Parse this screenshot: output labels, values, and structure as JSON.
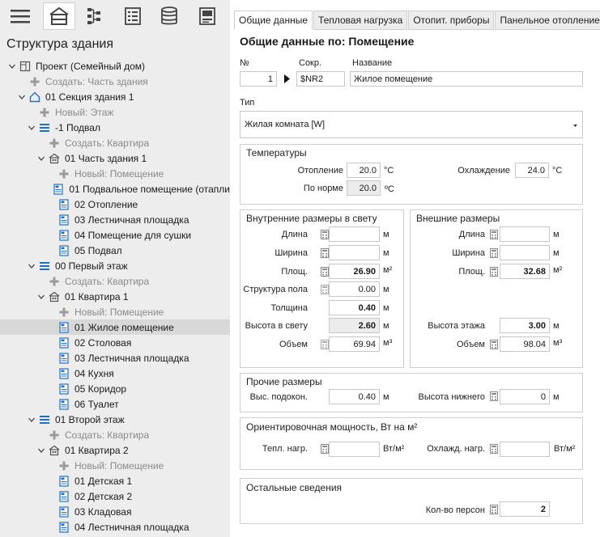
{
  "toolbar": {
    "buttons": [
      {
        "icon": "menu-icon"
      },
      {
        "icon": "building-icon"
      },
      {
        "icon": "network-icon"
      },
      {
        "icon": "list-icon"
      },
      {
        "icon": "database-icon"
      },
      {
        "icon": "panel-icon"
      }
    ]
  },
  "tree": {
    "title": "Структура здания",
    "items": [
      {
        "label": "Проект (Семейный дом)",
        "icon": "project-icon",
        "indent": 0,
        "expander": true,
        "gray": false
      },
      {
        "label": "Создать: Часть здания",
        "icon": "plus-icon",
        "indent": 1,
        "expander": false,
        "gray": true
      },
      {
        "label": "01 Секция здания 1",
        "icon": "house-icon",
        "indent": 1,
        "expander": true,
        "gray": false
      },
      {
        "label": "Новый: Этаж",
        "icon": "plus-icon",
        "indent": 2,
        "expander": false,
        "gray": true
      },
      {
        "label": "-1 Подвал",
        "icon": "floor-icon",
        "indent": 2,
        "expander": true,
        "gray": false
      },
      {
        "label": "Создать: Квартира",
        "icon": "plus-icon",
        "indent": 3,
        "expander": false,
        "gray": true
      },
      {
        "label": "01 Часть здания 1",
        "icon": "apartment-icon",
        "indent": 3,
        "expander": true,
        "gray": false
      },
      {
        "label": "Новый: Помещение",
        "icon": "plus-icon",
        "indent": 4,
        "expander": false,
        "gray": true
      },
      {
        "label": "01 Подвальное помещение (отапли",
        "icon": "room-icon",
        "indent": 4,
        "expander": false,
        "gray": false
      },
      {
        "label": "02 Отопление",
        "icon": "room-icon",
        "indent": 4,
        "expander": false,
        "gray": false
      },
      {
        "label": "03 Лестничная площадка",
        "icon": "room-icon",
        "indent": 4,
        "expander": false,
        "gray": false
      },
      {
        "label": "04 Помещение для сушки",
        "icon": "room-icon",
        "indent": 4,
        "expander": false,
        "gray": false
      },
      {
        "label": "05 Подвал",
        "icon": "room-icon",
        "indent": 4,
        "expander": false,
        "gray": false
      },
      {
        "label": "00 Первый этаж",
        "icon": "floor-icon",
        "indent": 2,
        "expander": true,
        "gray": false
      },
      {
        "label": "Создать: Квартира",
        "icon": "plus-icon",
        "indent": 3,
        "expander": false,
        "gray": true
      },
      {
        "label": "01 Квартира 1",
        "icon": "apartment-icon",
        "indent": 3,
        "expander": true,
        "gray": false
      },
      {
        "label": "Новый: Помещение",
        "icon": "plus-icon",
        "indent": 4,
        "expander": false,
        "gray": true
      },
      {
        "label": "01 Жилое помещение",
        "icon": "room-icon",
        "indent": 4,
        "expander": false,
        "gray": false,
        "selected": true
      },
      {
        "label": "02 Столовая",
        "icon": "room-icon",
        "indent": 4,
        "expander": false,
        "gray": false
      },
      {
        "label": "03 Лестничная площадка",
        "icon": "room-icon",
        "indent": 4,
        "expander": false,
        "gray": false
      },
      {
        "label": "04 Кухня",
        "icon": "room-icon",
        "indent": 4,
        "expander": false,
        "gray": false
      },
      {
        "label": "05 Коридор",
        "icon": "room-icon",
        "indent": 4,
        "expander": false,
        "gray": false
      },
      {
        "label": "06 Туалет",
        "icon": "room-icon",
        "indent": 4,
        "expander": false,
        "gray": false
      },
      {
        "label": "01 Второй этаж",
        "icon": "floor-icon",
        "indent": 2,
        "expander": true,
        "gray": false
      },
      {
        "label": "Создать: Квартира",
        "icon": "plus-icon",
        "indent": 3,
        "expander": false,
        "gray": true
      },
      {
        "label": "01 Квартира 2",
        "icon": "apartment-icon",
        "indent": 3,
        "expander": true,
        "gray": false
      },
      {
        "label": "Новый: Помещение",
        "icon": "plus-icon",
        "indent": 4,
        "expander": false,
        "gray": true
      },
      {
        "label": "01 Детская 1",
        "icon": "room-icon",
        "indent": 4,
        "expander": false,
        "gray": false
      },
      {
        "label": "02 Детская 2",
        "icon": "room-icon",
        "indent": 4,
        "expander": false,
        "gray": false
      },
      {
        "label": "03 Кладовая",
        "icon": "room-icon",
        "indent": 4,
        "expander": false,
        "gray": false
      },
      {
        "label": "04 Лестничная площадка",
        "icon": "room-icon",
        "indent": 4,
        "expander": false,
        "gray": false
      }
    ]
  },
  "tabs": [
    {
      "label": "Общие данные",
      "active": true
    },
    {
      "label": "Тепловая нагрузка",
      "active": false
    },
    {
      "label": "Отопит. приборы",
      "active": false
    },
    {
      "label": "Панельное отопление",
      "active": false
    }
  ],
  "form": {
    "title": "Общие данные по: Помещение",
    "number": {
      "label": "№",
      "value": "1"
    },
    "abbr": {
      "label": "Сокр.",
      "value": "$NR2"
    },
    "name": {
      "label": "Название",
      "value": "Жилое помещение"
    },
    "type": {
      "label": "Тип",
      "value": "Жилая комната [W]"
    },
    "temps": {
      "title": "Температуры",
      "heating_label": "Отопление",
      "heating_value": "20.0",
      "heating_unit": "°C",
      "cooling_label": "Охлаждение",
      "cooling_value": "24.0",
      "cooling_unit": "°C",
      "norm_label": "По норме",
      "norm_value": "20.0",
      "norm_unit": "ºC"
    },
    "inner": {
      "title": "Внутренние размеры в свету",
      "length_label": "Длина",
      "length_value": "",
      "length_unit": "м",
      "width_label": "Ширина",
      "width_value": "",
      "width_unit": "м",
      "area_label": "Площ.",
      "area_value": "26.90",
      "area_unit": "м²",
      "floor_label": "Структура пола",
      "floor_value": "0.00",
      "floor_unit": "м",
      "thick_label": "Толщина",
      "thick_value": "0.40",
      "thick_unit": "м",
      "clear_label": "Высота в свету",
      "clear_value": "2.60",
      "clear_unit": "м",
      "volume_label": "Объем",
      "volume_value": "69.94",
      "volume_unit": "м³"
    },
    "outer": {
      "title": "Внешние размеры",
      "length_label": "Длина",
      "length_value": "",
      "length_unit": "м",
      "width_label": "Ширина",
      "width_value": "",
      "width_unit": "м",
      "area_label": "Площ.",
      "area_value": "32.68",
      "area_unit": "м²",
      "height_label": "Высота этажа",
      "height_value": "3.00",
      "height_unit": "м",
      "volume_label": "Объем",
      "volume_value": "98.04",
      "volume_unit": "м³"
    },
    "other": {
      "title": "Прочие размеры",
      "sill_label": "Выс. подокон.",
      "sill_value": "0.40",
      "sill_unit": "м",
      "lower_label": "Высота нижнего",
      "lower_value": "0",
      "lower_unit": "м"
    },
    "power": {
      "title": "Ориентировочная мощность, Вт на м²",
      "heat_label": "Тепл. нагр.",
      "heat_value": "",
      "heat_unit": "Вт/м²",
      "cool_label": "Охлажд. нагр.",
      "cool_value": "",
      "cool_unit": "Вт/м²"
    },
    "rest": {
      "title": "Остальные сведения",
      "persons_label": "Кол-во персон",
      "persons_value": "2"
    }
  }
}
